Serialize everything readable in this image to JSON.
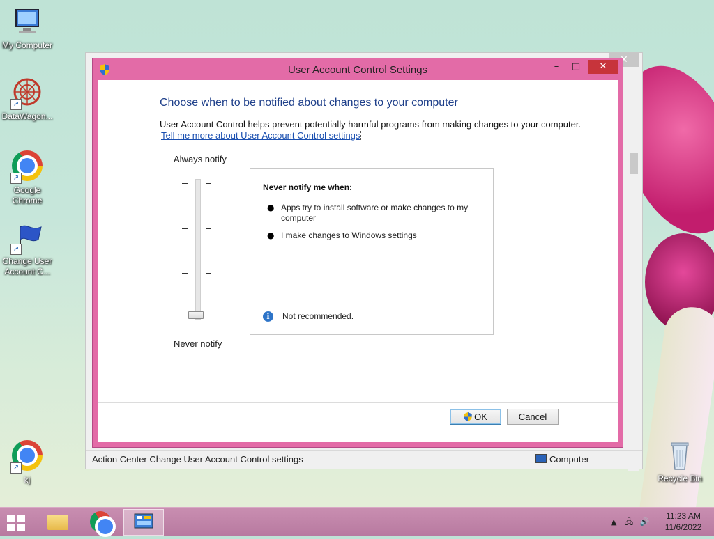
{
  "desktop": {
    "icons": [
      {
        "label": "My Computer"
      },
      {
        "label": "DataWagon..."
      },
      {
        "label": "Google Chrome"
      },
      {
        "label": "Change User Account C..."
      },
      {
        "label": "kj"
      },
      {
        "label": "Recycle Bin"
      }
    ]
  },
  "background_window": {
    "status_left": "Action Center Change User Account Control settings",
    "status_right": "Computer",
    "close_glyph": "✕"
  },
  "dialog": {
    "title": "User Account Control Settings",
    "heading": "Choose when to be notified about changes to your computer",
    "description": "User Account Control helps prevent potentially harmful programs from making changes to your computer.",
    "link": "Tell me more about User Account Control settings",
    "slider": {
      "top_label": "Always notify",
      "bottom_label": "Never notify",
      "levels": 4,
      "selected_level": 1
    },
    "info": {
      "title": "Never notify me when:",
      "bullets": [
        "Apps try to install software or make changes to my computer",
        "I make changes to Windows settings"
      ],
      "note": "Not recommended."
    },
    "buttons": {
      "ok": "OK",
      "cancel": "Cancel"
    },
    "controls": {
      "minimize": "–",
      "maximize": "□",
      "close": "✕"
    }
  },
  "taskbar": {
    "items": [
      "start-button",
      "file-explorer",
      "google-chrome",
      "control-panel"
    ],
    "clock_time": "11:23 AM",
    "clock_date": "11/6/2022"
  },
  "colors": {
    "dialog_frame": "#e36ba7",
    "taskbar": "#c98eb1",
    "heading": "#1e3f8a",
    "link": "#1a4fb0",
    "close_button": "#c7343b"
  }
}
